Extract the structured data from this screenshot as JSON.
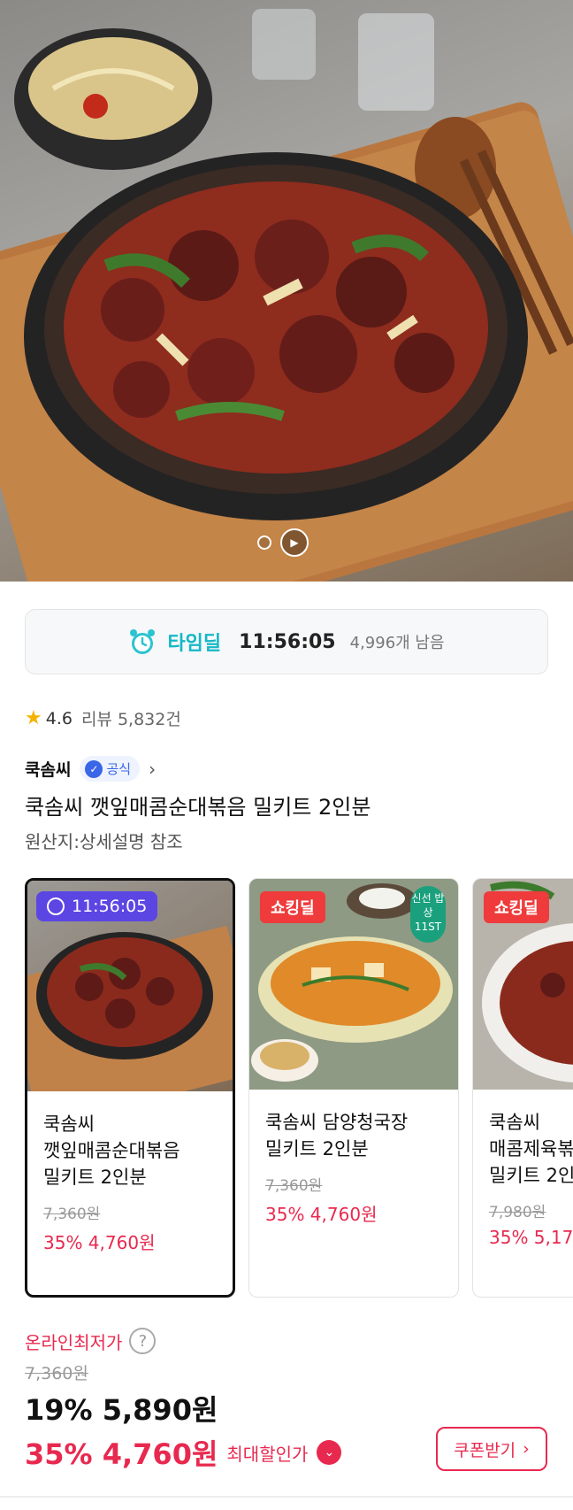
{
  "hero": {
    "slide_count": 2
  },
  "timedeal": {
    "label": "타임딜",
    "time": "11:56:05",
    "remaining": "4,996개 남음",
    "accent_color": "#15b8c6",
    "icon": "alarm-clock-icon"
  },
  "rating": {
    "score": "4.6",
    "review_text": "리뷰 5,832건",
    "icon": "star-icon"
  },
  "brand": {
    "name": "쿡솜씨",
    "official_label": "공식",
    "icon": "verified-check-icon"
  },
  "product": {
    "title": "쿡솜씨 깻잎매콤순대볶음 밀키트 2인분",
    "origin": "원산지:상세설명 참조"
  },
  "cards": [
    {
      "badge": "11:56:05",
      "name_lines": [
        "쿡솜씨",
        "깻잎매콤순대볶음",
        "밀키트 2인분"
      ],
      "orig_price": "7,360원",
      "discount": "35% 4,760원",
      "selected": true
    },
    {
      "badge": "쇼킹딜",
      "fresh_badge": "신선 밥상 11ST",
      "name_lines": [
        "쿡솜씨 담양청국장",
        "밀키트 2인분"
      ],
      "orig_price": "7,360원",
      "discount": "35% 4,760원"
    },
    {
      "badge": "쇼킹딜",
      "name_lines": [
        "쿡솜씨",
        "매콤제육볶",
        "밀키트 2인"
      ],
      "orig_price": "7,980원",
      "discount": "35% 5,17"
    }
  ],
  "price": {
    "lowest_label": "온라인최저가",
    "help_glyph": "?",
    "orig": "7,360원",
    "main": "19% 5,890원",
    "max_discount": "35% 4,760원",
    "max_label": "최대할인가",
    "coupon_label": "쿠폰받기",
    "accent_color": "#e8294f"
  }
}
